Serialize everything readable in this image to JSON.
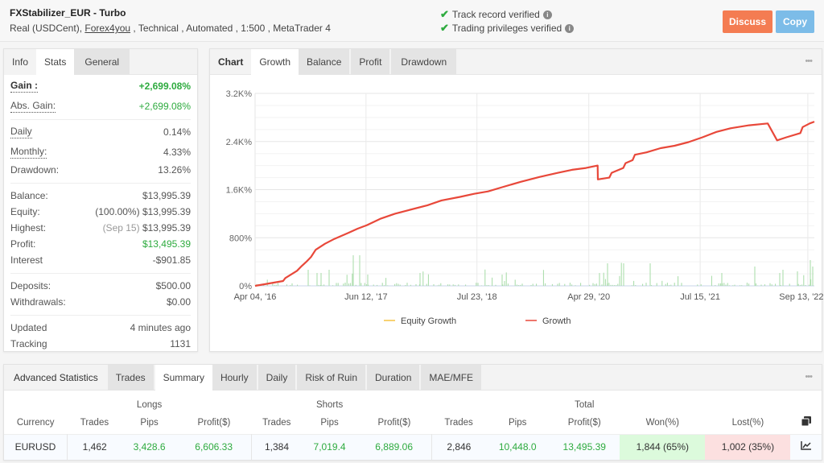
{
  "header": {
    "title": "FXStabilizer_EUR - Turbo",
    "subtitle_prefix": "Real (USDCent), ",
    "broker": "Forex4you",
    "subtitle_suffix": " , Technical , Automated , 1:500 , MetaTrader 4",
    "verified": [
      "Track record verified",
      "Trading privileges verified"
    ],
    "discuss_label": "Discuss",
    "copy_label": "Copy"
  },
  "left_panel": {
    "tabs": [
      "Info",
      "Stats",
      "General"
    ],
    "active_tab": "Stats",
    "gain_label": "Gain :",
    "gain": "+2,699.08%",
    "abs_gain_label": "Abs. Gain:",
    "abs_gain": "+2,699.08%",
    "daily_label": "Daily",
    "daily": "0.14%",
    "monthly_label": "Monthly:",
    "monthly": "4.33%",
    "drawdown_label": "Drawdown:",
    "drawdown": "13.26%",
    "balance_label": "Balance:",
    "balance": "$13,995.39",
    "equity_label": "Equity:",
    "equity_pct": "(100.00%)",
    "equity": "$13,995.39",
    "highest_label": "Highest:",
    "highest_date": "(Sep 15)",
    "highest": "$13,995.39",
    "profit_label": "Profit:",
    "profit": "$13,495.39",
    "interest_label": "Interest",
    "interest": "-$901.85",
    "deposits_label": "Deposits:",
    "deposits": "$500.00",
    "withdrawals_label": "Withdrawals:",
    "withdrawals": "$0.00",
    "updated_label": "Updated",
    "updated": "4 minutes ago",
    "tracking_label": "Tracking",
    "tracking": "1131"
  },
  "chart_panel": {
    "tabs": [
      "Chart",
      "Growth",
      "Balance",
      "Profit",
      "Drawdown"
    ],
    "active_tab": "Growth",
    "more_icon": "•••"
  },
  "chart_data": {
    "type": "line",
    "title": "",
    "xlabel": "",
    "ylabel": "",
    "ylim": [
      0,
      3200
    ],
    "yticks": [
      0,
      800,
      1600,
      2400,
      3200
    ],
    "ytick_labels": [
      "0%",
      "800%",
      "1.6K%",
      "2.4K%",
      "3.2K%"
    ],
    "xtick_labels": [
      "Apr 04, '16",
      "Jun 12, '17",
      "Jul 23, '18",
      "Apr 29, '20",
      "Jul 15, '21",
      "Sep 13, '22"
    ],
    "x_range_dates": [
      "2016-04-04",
      "2022-09-13"
    ],
    "grid": true,
    "legend": {
      "placement": "bottom",
      "entries": [
        {
          "name": "Equity Growth",
          "color": "#f5c242"
        },
        {
          "name": "Growth",
          "color": "#e8483a"
        }
      ]
    },
    "series": [
      {
        "name": "Growth",
        "color": "#e8483a",
        "points_t_frac_value": [
          [
            0.0,
            0
          ],
          [
            0.03,
            40
          ],
          [
            0.06,
            80
          ],
          [
            0.065,
            130
          ],
          [
            0.09,
            250
          ],
          [
            0.1,
            330
          ],
          [
            0.11,
            400
          ],
          [
            0.12,
            480
          ],
          [
            0.13,
            600
          ],
          [
            0.15,
            700
          ],
          [
            0.17,
            780
          ],
          [
            0.2,
            880
          ],
          [
            0.22,
            950
          ],
          [
            0.24,
            1010
          ],
          [
            0.27,
            1120
          ],
          [
            0.3,
            1200
          ],
          [
            0.33,
            1260
          ],
          [
            0.37,
            1340
          ],
          [
            0.4,
            1420
          ],
          [
            0.44,
            1480
          ],
          [
            0.47,
            1530
          ],
          [
            0.5,
            1570
          ],
          [
            0.53,
            1640
          ],
          [
            0.57,
            1730
          ],
          [
            0.61,
            1810
          ],
          [
            0.65,
            1880
          ],
          [
            0.68,
            1930
          ],
          [
            0.71,
            1960
          ],
          [
            0.735,
            2000
          ],
          [
            0.7355,
            1770
          ],
          [
            0.76,
            1800
          ],
          [
            0.765,
            1880
          ],
          [
            0.79,
            1960
          ],
          [
            0.795,
            2040
          ],
          [
            0.81,
            2090
          ],
          [
            0.815,
            2180
          ],
          [
            0.84,
            2220
          ],
          [
            0.87,
            2290
          ],
          [
            0.9,
            2330
          ],
          [
            0.93,
            2390
          ],
          [
            0.96,
            2470
          ],
          [
            0.99,
            2560
          ],
          [
            1.02,
            2620
          ],
          [
            1.06,
            2670
          ],
          [
            1.1,
            2700
          ],
          [
            1.12,
            2420
          ],
          [
            1.14,
            2470
          ],
          [
            1.17,
            2540
          ],
          [
            1.175,
            2640
          ],
          [
            1.19,
            2700
          ],
          [
            1.2,
            2730
          ]
        ]
      },
      {
        "name": "Equity Growth",
        "color": "#f5c242",
        "note": "overlaps Growth line"
      }
    ],
    "volume_bars_note": "green daily profit bars along the bottom, heights up to ~20% of axis"
  },
  "bottom_panel": {
    "tabs": [
      "Advanced Statistics",
      "Trades",
      "Summary",
      "Hourly",
      "Daily",
      "Risk of Ruin",
      "Duration",
      "MAE/MFE"
    ],
    "active_tab": "Summary",
    "more_icon": "•••",
    "groups": {
      "longs": "Longs",
      "shorts": "Shorts",
      "total": "Total"
    },
    "columns": [
      "Currency",
      "Trades",
      "Pips",
      "Profit($)",
      "Trades",
      "Pips",
      "Profit($)",
      "Trades",
      "Pips",
      "Profit($)",
      "Won(%)",
      "Lost(%)"
    ],
    "rows": [
      [
        "EURUSD",
        "1,462",
        "3,428.6",
        "6,606.33",
        "1,384",
        "7,019.4",
        "6,889.06",
        "2,846",
        "10,448.0",
        "13,495.39",
        "1,844 (65%)",
        "1,002 (35%)"
      ]
    ]
  }
}
